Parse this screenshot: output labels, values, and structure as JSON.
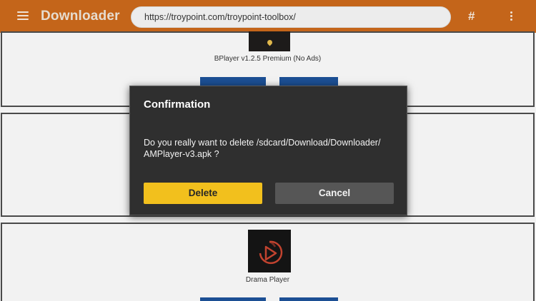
{
  "app": {
    "title": "Downloader",
    "url": "https://troypoint.com/troypoint-toolbox/"
  },
  "list": {
    "items": [
      {
        "label": "BPlayer v1.2.5 Premium (No Ads)"
      },
      {
        "label": ""
      },
      {
        "label": "Drama Player"
      }
    ]
  },
  "dialog": {
    "title": "Confirmation",
    "message_line1": "Do you really want to delete /sdcard/Download/Downloader/",
    "message_line2": "AMPlayer-v3.apk ?",
    "delete_label": "Delete",
    "cancel_label": "Cancel"
  },
  "colors": {
    "appbar": "#c4651a",
    "dialog_bg": "#2f2f2f",
    "delete_button": "#f2c01d",
    "cancel_button": "#565656",
    "list_action_button": "#1c4f94"
  },
  "icons": {
    "menu": "hamburger-menu-icon",
    "hash": "hash-icon",
    "more": "more-vertical-icon"
  }
}
